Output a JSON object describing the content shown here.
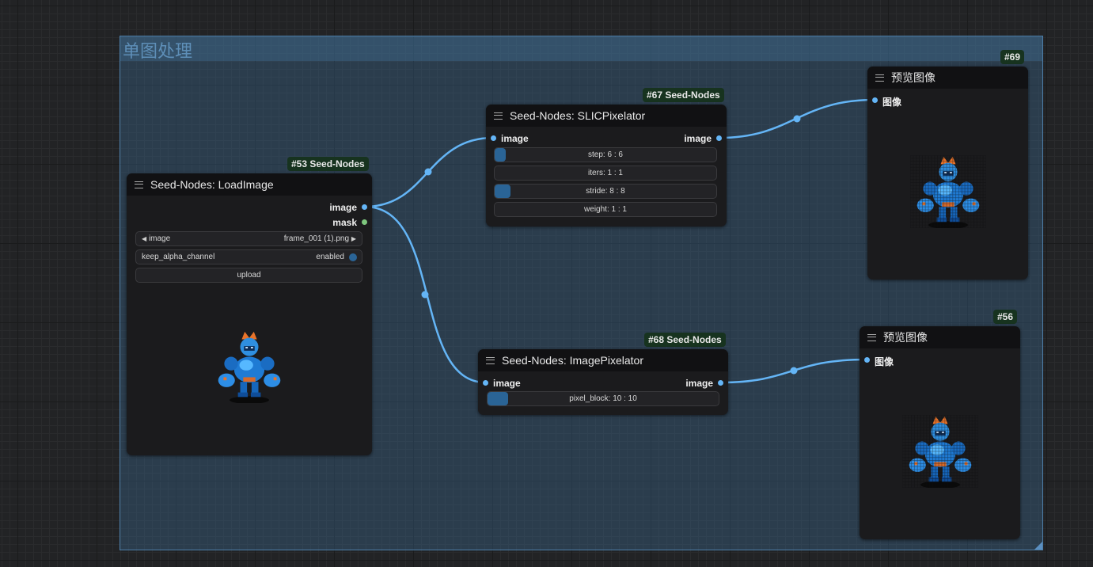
{
  "group": {
    "title": "单图处理"
  },
  "nodes": {
    "load_image": {
      "badge": "#53 Seed-Nodes",
      "title": "Seed-Nodes: LoadImage",
      "outputs": [
        "image",
        "mask"
      ],
      "widgets": {
        "image": {
          "label": "image",
          "value": "frame_001 (1).png"
        },
        "keep_alpha_channel": {
          "label": "keep_alpha_channel",
          "value": "enabled"
        },
        "upload": {
          "label": "upload"
        }
      }
    },
    "slic": {
      "badge": "#67 Seed-Nodes",
      "title": "Seed-Nodes: SLICPixelator",
      "input": "image",
      "output": "image",
      "widgets": [
        {
          "text": "step: 6 : 6",
          "fraction": 0.05
        },
        {
          "text": "iters: 1 : 1",
          "fraction": 0.0
        },
        {
          "text": "stride: 8 : 8",
          "fraction": 0.07
        },
        {
          "text": "weight: 1 : 1",
          "fraction": 0.0
        }
      ]
    },
    "image_pixelator": {
      "badge": "#68 Seed-Nodes",
      "title": "Seed-Nodes: ImagePixelator",
      "input": "image",
      "output": "image",
      "widgets": [
        {
          "text": "pixel_block: 10 : 10",
          "fraction": 0.09
        }
      ]
    },
    "preview_69": {
      "badge": "#69",
      "title": "预览图像",
      "input": "图像"
    },
    "preview_56": {
      "badge": "#56",
      "title": "预览图像",
      "input": "图像"
    }
  },
  "colors": {
    "link": "#64b5f6",
    "group": "#3a6991",
    "badge_bg": "#17331f",
    "widget_fill": "#2a6496"
  },
  "icons": [
    "menu-icon",
    "arrow-left-icon",
    "arrow-right-icon",
    "toggle-dot-icon",
    "robot-sprite-image"
  ]
}
